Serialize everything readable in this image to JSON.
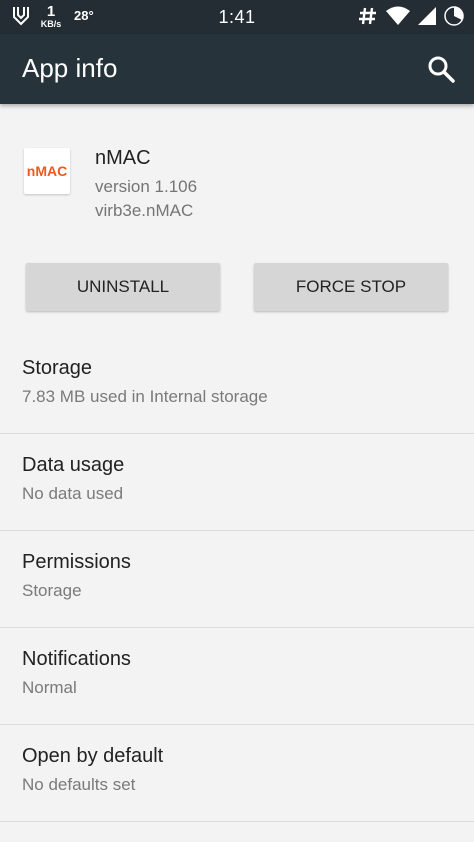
{
  "status_bar": {
    "net_speed_value": "1",
    "net_speed_unit": "KB/s",
    "temperature": "28°",
    "time": "1:41",
    "battery": "39",
    "icons": [
      "usb-debug-icon",
      "hash-icon",
      "wifi-icon",
      "cell-signal-icon",
      "battery-icon"
    ]
  },
  "app_bar": {
    "title": "App info",
    "search_icon": "search-icon"
  },
  "app": {
    "icon_text": "nMAC",
    "icon_color": "#ec5a1f",
    "name": "nMAC",
    "version": "version 1.106",
    "package": "virb3e.nMAC"
  },
  "buttons": {
    "uninstall": "UNINSTALL",
    "force_stop": "FORCE STOP"
  },
  "items": [
    {
      "title": "Storage",
      "subtitle": "7.83 MB used in Internal storage"
    },
    {
      "title": "Data usage",
      "subtitle": "No data used"
    },
    {
      "title": "Permissions",
      "subtitle": "Storage"
    },
    {
      "title": "Notifications",
      "subtitle": "Normal"
    },
    {
      "title": "Open by default",
      "subtitle": "No defaults set"
    }
  ],
  "colors": {
    "status_bar": "#242d33",
    "app_bar": "#27333a",
    "background": "#f3f3f3"
  }
}
